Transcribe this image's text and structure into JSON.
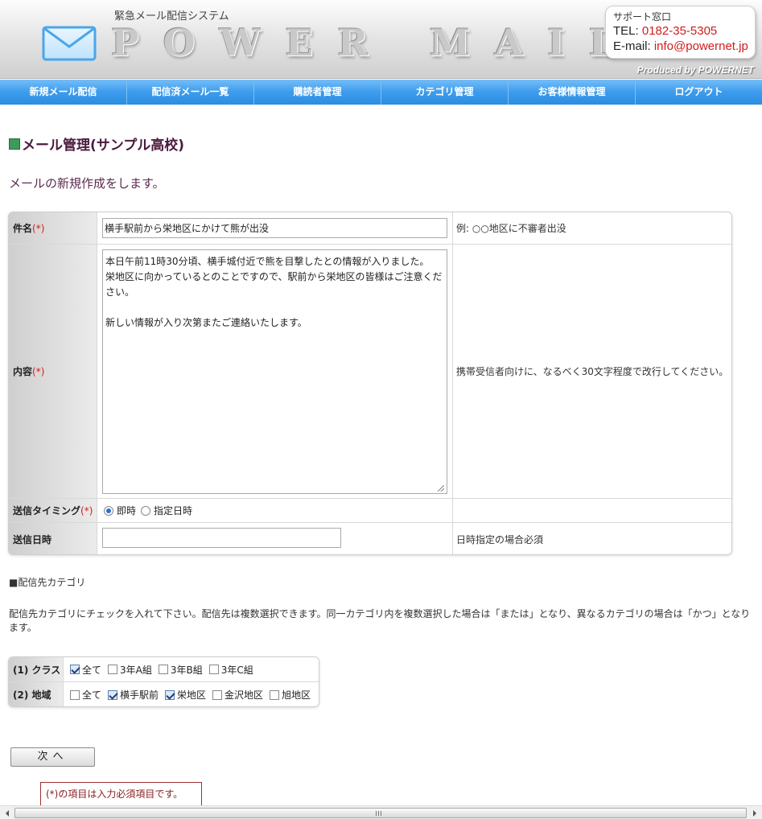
{
  "header": {
    "tagline": "緊急メール配信システム",
    "logo_text": "POWER MAIL",
    "support": {
      "title": "サポート窓口",
      "tel_label": "TEL:",
      "tel_value": "0182-35-5305",
      "email_label": "E-mail:",
      "email_value": "info@powernet.jp"
    },
    "produced_by": "Produced by POWERNET"
  },
  "nav": {
    "items": [
      {
        "label": "新規メール配信"
      },
      {
        "label": "配信済メール一覧"
      },
      {
        "label": "購読者管理"
      },
      {
        "label": "カテゴリ管理"
      },
      {
        "label": "お客様情報管理"
      },
      {
        "label": "ログアウト"
      }
    ]
  },
  "page": {
    "title": "メール管理(サンプル高校)",
    "description": "メールの新規作成をします。"
  },
  "form": {
    "required_mark": "(*)",
    "subject": {
      "label": "件名",
      "value": "横手駅前から栄地区にかけて熊が出没",
      "note": "例: ○○地区に不審者出没"
    },
    "body": {
      "label": "内容",
      "value": "本日午前11時30分頃、横手城付近で熊を目撃したとの情報が入りました。\n栄地区に向かっているとのことですので、駅前から栄地区の皆様はご注意ください。\n\n新しい情報が入り次第またご連絡いたします。",
      "note": "携帯受信者向けに、なるべく30文字程度で改行してください。"
    },
    "timing": {
      "label": "送信タイミング",
      "options": [
        {
          "label": "即時",
          "checked": true
        },
        {
          "label": "指定日時",
          "checked": false
        }
      ]
    },
    "send_datetime": {
      "label": "送信日時",
      "value": "",
      "note": "日時指定の場合必須"
    }
  },
  "categories": {
    "heading": "■配信先カテゴリ",
    "description": "配信先カテゴリにチェックを入れて下さい。配信先は複数選択できます。同一カテゴリ内を複数選択した場合は「または」となり、異なるカテゴリの場合は「かつ」となります。",
    "groups": [
      {
        "label": "(1) クラス",
        "options": [
          {
            "label": "全て",
            "checked": true
          },
          {
            "label": "3年A組",
            "checked": false
          },
          {
            "label": "3年B組",
            "checked": false
          },
          {
            "label": "3年C組",
            "checked": false
          }
        ]
      },
      {
        "label": "(2) 地域",
        "options": [
          {
            "label": "全て",
            "checked": false
          },
          {
            "label": "横手駅前",
            "checked": true
          },
          {
            "label": "栄地区",
            "checked": true
          },
          {
            "label": "金沢地区",
            "checked": false
          },
          {
            "label": "旭地区",
            "checked": false
          }
        ]
      }
    ]
  },
  "actions": {
    "next_label": "次へ"
  },
  "footer_note": "(*)の項目は入力必須項目です。",
  "colors": {
    "nav_blue": "#3d9cec",
    "required_red": "#d01c1c",
    "title_color": "#4a1a3e",
    "marker_green": "#3c9a5a"
  }
}
